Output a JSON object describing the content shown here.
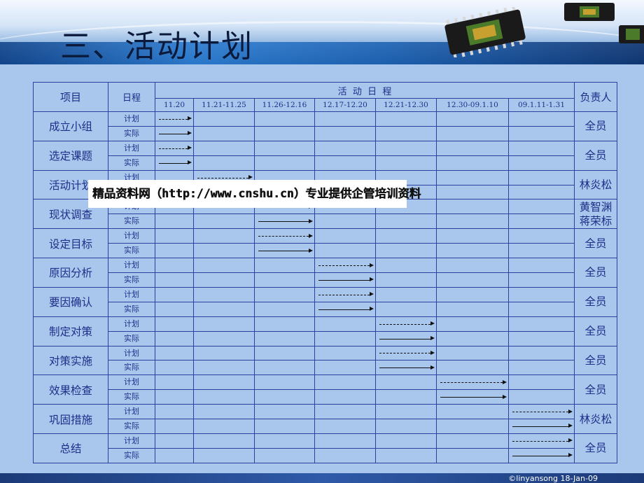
{
  "title": "三、活动计划",
  "table": {
    "header_item": "项目",
    "header_schedule": "日程",
    "header_activity": "活  动  日  程",
    "header_owner": "负责人",
    "dates": [
      "11.20",
      "11.21-11.25",
      "11.26-12.16",
      "12.17-12.20",
      "12.21-12.30",
      "12.30-09.1.10",
      "09.1.11-1.31"
    ],
    "plan_label": "计划",
    "actual_label": "实际",
    "rows": [
      {
        "task": "成立小组",
        "plan_col": 0,
        "actual_col": 0,
        "owner": "全员"
      },
      {
        "task": "选定课题",
        "plan_col": 0,
        "actual_col": 0,
        "owner": "全员"
      },
      {
        "task": "活动计划",
        "plan_col": 1,
        "actual_col": 1,
        "owner": "林炎松"
      },
      {
        "task": "现状调查",
        "plan_col": 2,
        "actual_col": 2,
        "owner": "黄智渊\n蒋荣标"
      },
      {
        "task": "设定目标",
        "plan_col": 2,
        "actual_col": 2,
        "owner": "全员"
      },
      {
        "task": "原因分析",
        "plan_col": 3,
        "actual_col": 3,
        "owner": "全员"
      },
      {
        "task": "要因确认",
        "plan_col": 3,
        "actual_col": 3,
        "owner": "全员"
      },
      {
        "task": "制定对策",
        "plan_col": 4,
        "actual_col": 4,
        "owner": "全员"
      },
      {
        "task": "对策实施",
        "plan_col": 4,
        "actual_col": 4,
        "owner": "全员"
      },
      {
        "task": "效果检查",
        "plan_col": 5,
        "actual_col": 5,
        "owner": "全员"
      },
      {
        "task": "巩固措施",
        "plan_col": 6,
        "actual_col": 6,
        "owner": "林炎松"
      },
      {
        "task": "总结",
        "plan_col": 6,
        "actual_col": 6,
        "owner": "全员"
      }
    ]
  },
  "watermark": "精品资料网（http://www.cnshu.cn）专业提供企管培训资料",
  "footer": "©linyansong 18-Jan-09",
  "colors": {
    "background": "#a9c6ec",
    "grid": "#2e3f9e",
    "text": "#1d2f88"
  }
}
